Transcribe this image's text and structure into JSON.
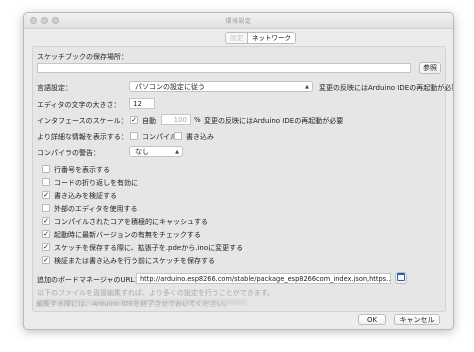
{
  "window": {
    "title": "環境設定",
    "tabs": [
      "設定",
      "ネットワーク"
    ]
  },
  "sketchbook": {
    "label": "スケッチブックの保存場所：",
    "path": "",
    "browse": "参照"
  },
  "language": {
    "label": "言語設定：",
    "value": "パソコンの設定に従う",
    "note": "変更の反映にはArduino IDEの再起動が必要"
  },
  "font_size": {
    "label": "エディタの文字の大きさ：",
    "value": "12"
  },
  "scale": {
    "label": "インタフェースのスケール：",
    "auto_label": "自動",
    "auto_checked": true,
    "value": "100",
    "unit": "%",
    "note": "変更の反映にはArduino IDEの再起動が必要"
  },
  "verbose": {
    "label": "より詳細な情報を表示する：",
    "compile": "コンパイル",
    "upload": "書き込み"
  },
  "warnings": {
    "label": "コンパイラの警告：",
    "value": "なし"
  },
  "options": [
    {
      "label": "行番号を表示する",
      "checked": false
    },
    {
      "label": "コードの折り返しを有効に",
      "checked": false
    },
    {
      "label": "書き込みを検証する",
      "checked": true
    },
    {
      "label": "外部のエディタを使用する",
      "checked": false
    },
    {
      "label": "コンパイルされたコアを積極的にキャッシュする",
      "checked": true
    },
    {
      "label": "起動時に最新バージョンの有無をチェックする",
      "checked": true
    },
    {
      "label": "スケッチを保存する際に、拡張子を.pdeから.inoに変更する",
      "checked": true
    },
    {
      "label": "検証または書き込みを行う前にスケッチを保存する",
      "checked": true
    }
  ],
  "board_urls": {
    "label": "追加のボードマネージャのURL：",
    "value": "http://arduino.esp8266.com/stable/package_esp8266com_index.json,https..."
  },
  "hints": {
    "direct_edit": "以下のファイルを直接編集すれば、より多くの設定を行うことができます。",
    "restart_note": "編集する際には、Arduino IDEを終了させておいてください。"
  },
  "buttons": {
    "ok": "OK",
    "cancel": "キャンセル"
  }
}
